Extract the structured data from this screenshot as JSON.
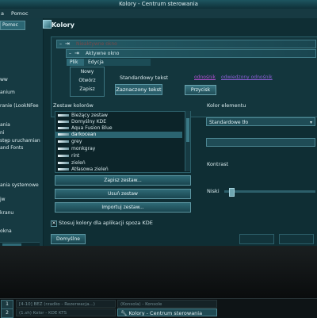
{
  "window": {
    "title": "Kolory - Centrum sterowania"
  },
  "menubar": {
    "items": [
      "a",
      "Pomoc"
    ]
  },
  "sidebar": {
    "tab_label": "Pomoc",
    "items": [
      "ww",
      "anium",
      "ranie (LookNFee",
      "ania",
      "ni",
      "stęp uruchamian",
      "and Fonts",
      "ania systemowe",
      "jw",
      "kranu",
      "okna"
    ]
  },
  "header": {
    "title": "Kolory"
  },
  "preview": {
    "inactive_title": "Nieaktywne okno",
    "active_title": "Aktywne okno",
    "menu": [
      "Plik",
      "Edycja"
    ],
    "dropdown": [
      "Nowy",
      "Otwórz",
      "Zapisz"
    ],
    "standard_text": "Standardowy tekst",
    "selected_text": "Zaznaczony tekst",
    "link": "odnośnik",
    "visited_link": "odwiedzony odnośnik",
    "button": "Przycisk"
  },
  "color_scheme": {
    "title": "Zestaw kolorów",
    "items": [
      "Bieżący zestaw",
      "Domyślny KDE",
      "Aqua Fusion Blue",
      "darkocean",
      "grey",
      "monkgray",
      "rint",
      "zieleń",
      "Atłasowa zieleń"
    ],
    "selected_index": 3,
    "save_button": "Zapisz zestaw...",
    "delete_button": "Usuń zestaw",
    "import_button": "Importuj zestaw..."
  },
  "widget_color": {
    "title": "Kolor elementu",
    "selected": "Standardowe tło",
    "contrast_label": "Kontrast",
    "low_label": "Niski",
    "contrast_level": 0.05
  },
  "apply_checkbox": {
    "checked": true,
    "label": "Stosuj kolory dla aplikacji spoza KDE"
  },
  "buttons": {
    "defaults": "Domyślne"
  },
  "taskbar": {
    "pager": [
      "1",
      "2"
    ],
    "items": [
      "[4-10] BEZ (rzadko - Rezerwacja...)",
      "(Konsola) - Konsole",
      "(1.sh) Kolor - KDE KTS",
      "Kolory - Centrum sterowania"
    ],
    "active_index": 3
  }
}
